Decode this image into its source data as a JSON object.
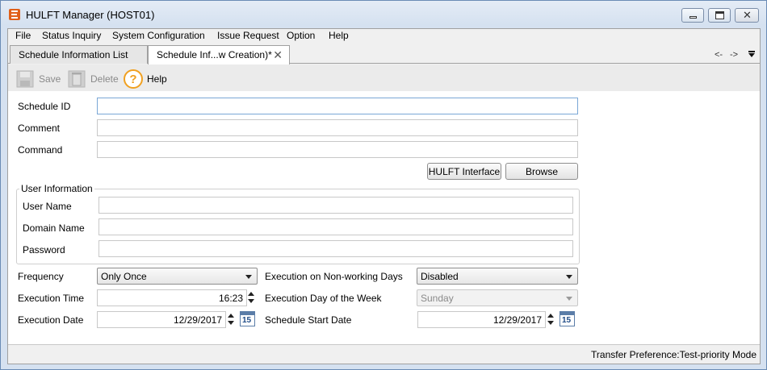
{
  "window": {
    "title": "HULFT Manager (HOST01)"
  },
  "menu": [
    {
      "label": "File"
    },
    {
      "label": "Status Inquiry"
    },
    {
      "label": "System Configuration"
    },
    {
      "label": "Issue Request"
    },
    {
      "label": "Option"
    },
    {
      "label": "Help"
    }
  ],
  "tabs": [
    {
      "label": "Schedule Information List"
    },
    {
      "label": "Schedule Inf...w Creation)*"
    }
  ],
  "nav": {
    "back": "<-",
    "forward": "->"
  },
  "toolbar": {
    "save": "Save",
    "delete": "Delete",
    "help": "Help"
  },
  "form": {
    "schedule_id_label": "Schedule ID",
    "schedule_id_value": "",
    "comment_label": "Comment",
    "comment_value": "",
    "command_label": "Command",
    "command_value": "",
    "hulft_interface_button": "HULFT Interface",
    "browse_button": "Browse",
    "user_info_title": "User Information",
    "user_name_label": "User Name",
    "domain_name_label": "Domain Name",
    "password_label": "Password",
    "frequency_label": "Frequency",
    "frequency_value": "Only Once",
    "exec_nonworking_label": "Execution on Non-working Days",
    "exec_nonworking_value": "Disabled",
    "exec_time_label": "Execution Time",
    "exec_time_value": "16:23",
    "exec_dow_label": "Execution Day of the Week",
    "exec_dow_value": "Sunday",
    "exec_date_label": "Execution Date",
    "exec_date_value": "12/29/2017",
    "start_date_label": "Schedule Start Date",
    "start_date_value": "12/29/2017",
    "calendar_number": "15"
  },
  "status": {
    "text": "Transfer Preference:Test-priority Mode"
  }
}
